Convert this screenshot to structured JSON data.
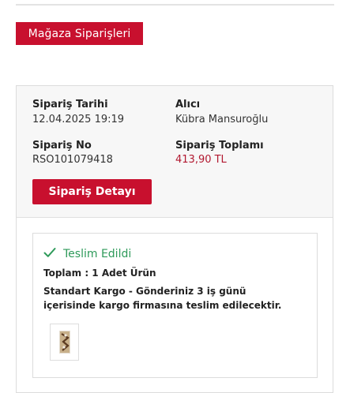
{
  "store_orders_button": {
    "label": "Mağaza Siparişleri"
  },
  "order": {
    "date_label": "Sipariş Tarihi",
    "date_value": "12.04.2025 19:19",
    "recipient_label": "Alıcı",
    "recipient_value": "Kübra Mansuroğlu",
    "number_label": "Sipariş No",
    "number_value": "RSO101079418",
    "total_label": "Sipariş Toplamı",
    "total_value": "413,90 TL",
    "detail_button": "Sipariş Detayı"
  },
  "shipment": {
    "status_icon": "check-icon",
    "status": "Teslim Edildi",
    "total_line": "Toplam : 1 Adet Ürün",
    "cargo_note": "Standart Kargo - Gönderiniz 3 iş günü içerisinde kargo firmasına teslim edilecektir.",
    "product_image": "product-thumbnail"
  },
  "colors": {
    "brand_red": "#c8102e",
    "price_red": "#b21830",
    "status_green": "#2e9a5a"
  }
}
